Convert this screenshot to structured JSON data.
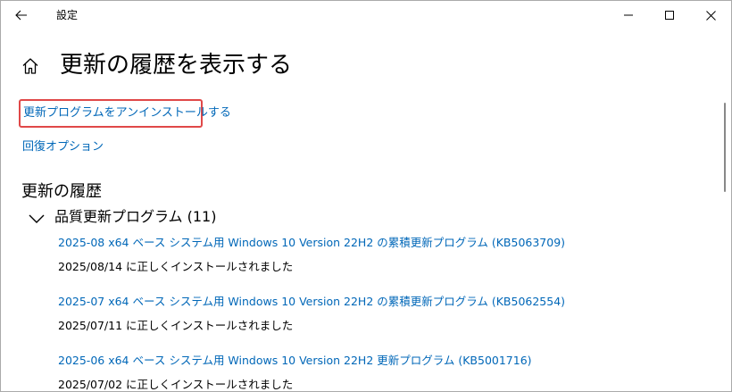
{
  "window": {
    "title": "設定"
  },
  "page": {
    "title": "更新の履歴を表示する"
  },
  "links": {
    "uninstall_updates": "更新プログラムをアンインストールする",
    "recovery_options": "回復オプション"
  },
  "history": {
    "heading": "更新の履歴",
    "groups": [
      {
        "label": "品質更新プログラム (11)",
        "items": [
          {
            "title": "2025-08 x64 ベース システム用 Windows 10 Version 22H2 の累積更新プログラム (KB5063709)",
            "status": "2025/08/14 に正しくインストールされました"
          },
          {
            "title": "2025-07 x64 ベース システム用 Windows 10 Version 22H2 の累積更新プログラム (KB5062554)",
            "status": "2025/07/11 に正しくインストールされました"
          },
          {
            "title": "2025-06 x64 ベース システム用 Windows 10 Version 22H2 更新プログラム (KB5001716)",
            "status": "2025/07/02 に正しくインストールされました"
          }
        ]
      }
    ]
  },
  "icons": {
    "back": "back-arrow-icon",
    "minimize": "minimize-icon",
    "maximize": "maximize-icon",
    "close": "close-icon",
    "home": "home-icon",
    "group_toggle": "chevron-down-icon"
  },
  "colors": {
    "link": "#0067b8",
    "highlight_border": "#e04848",
    "text": "#000000",
    "background": "#ffffff"
  }
}
